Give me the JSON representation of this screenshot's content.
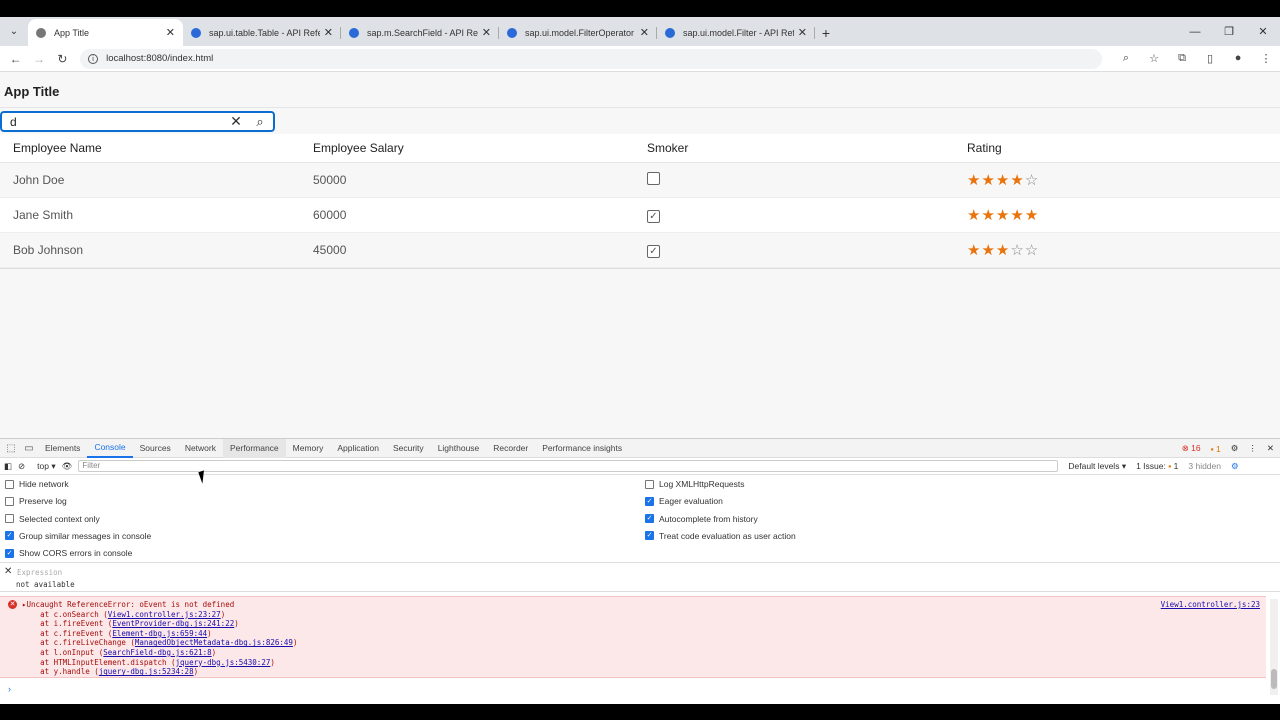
{
  "browser": {
    "tabs": [
      {
        "title": "App Title",
        "active": true
      },
      {
        "title": "sap.ui.table.Table - API Referen...",
        "active": false
      },
      {
        "title": "sap.m.SearchField - API Referen...",
        "active": false
      },
      {
        "title": "sap.ui.model.FilterOperator - AP...",
        "active": false
      },
      {
        "title": "sap.ui.model.Filter - API Refere...",
        "active": false
      }
    ],
    "url": "localhost:8080/index.html"
  },
  "app": {
    "title": "App Title",
    "search_value": "d",
    "columns": [
      "Employee Name",
      "Employee Salary",
      "Smoker",
      "Rating"
    ],
    "rows": [
      {
        "name": "John Doe",
        "salary": "50000",
        "smoker": false,
        "rating": 4
      },
      {
        "name": "Jane Smith",
        "salary": "60000",
        "smoker": true,
        "rating": 5
      },
      {
        "name": "Bob Johnson",
        "salary": "45000",
        "smoker": true,
        "rating": 3
      }
    ],
    "rating_max": 5,
    "accent_color": "#e9730c"
  },
  "devtools": {
    "tabs": [
      "Elements",
      "Console",
      "Sources",
      "Network",
      "Performance",
      "Memory",
      "Application",
      "Security",
      "Lighthouse",
      "Recorder",
      "Performance insights"
    ],
    "selected_tab": "Console",
    "error_count": "16",
    "warn_count": "1",
    "context": "top",
    "filter_placeholder": "Filter",
    "default_levels": "Default levels",
    "issues": "1 Issue:",
    "issues_count": "1",
    "hidden": "3 hidden",
    "options_left": [
      {
        "label": "Hide network",
        "checked": false
      },
      {
        "label": "Preserve log",
        "checked": false
      },
      {
        "label": "Selected context only",
        "checked": false
      },
      {
        "label": "Group similar messages in console",
        "checked": true
      },
      {
        "label": "Show CORS errors in console",
        "checked": true
      }
    ],
    "options_right": [
      {
        "label": "Log XMLHttpRequests",
        "checked": false
      },
      {
        "label": "Eager evaluation",
        "checked": true
      },
      {
        "label": "Autocomplete from history",
        "checked": true
      },
      {
        "label": "Treat code evaluation as user action",
        "checked": true
      }
    ],
    "expression_placeholder": "Expression",
    "expression_value": "not available",
    "error_message": "Uncaught ReferenceError: oEvent is not defined",
    "error_source": "View1.controller.js:23",
    "stack": [
      {
        "prefix": "at c.onSearch (",
        "link": "View1.controller.js:23:27",
        "suffix": ")"
      },
      {
        "prefix": "at i.fireEvent (",
        "link": "EventProvider-dbg.js:241:22",
        "suffix": ")"
      },
      {
        "prefix": "at c.fireEvent (",
        "link": "Element-dbg.js:659:44",
        "suffix": ")"
      },
      {
        "prefix": "at c.fireLiveChange (",
        "link": "ManagedObjectMetadata-dbg.js:826:49",
        "suffix": ")"
      },
      {
        "prefix": "at l.onInput (",
        "link": "SearchField-dbg.js:621:8",
        "suffix": ")"
      },
      {
        "prefix": "at HTMLInputElement.dispatch (",
        "link": "jquery-dbg.js:5430:27",
        "suffix": ")"
      },
      {
        "prefix": "at y.handle (",
        "link": "jquery-dbg.js:5234:28",
        "suffix": ")"
      }
    ]
  }
}
